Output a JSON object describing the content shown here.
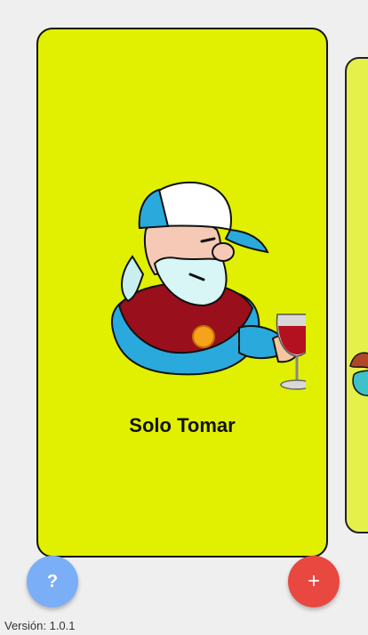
{
  "cards": {
    "current": {
      "title": "Solo Tomar",
      "background": "#e0f000",
      "image": "old-man-with-wine-glass-illustration"
    },
    "next": {
      "background": "#e6f04a"
    }
  },
  "actions": {
    "help_label": "?",
    "help_color": "#7aaef7",
    "add_label": "+",
    "add_color": "#e8483f"
  },
  "footer": {
    "version": "Versión: 1.0.1"
  }
}
